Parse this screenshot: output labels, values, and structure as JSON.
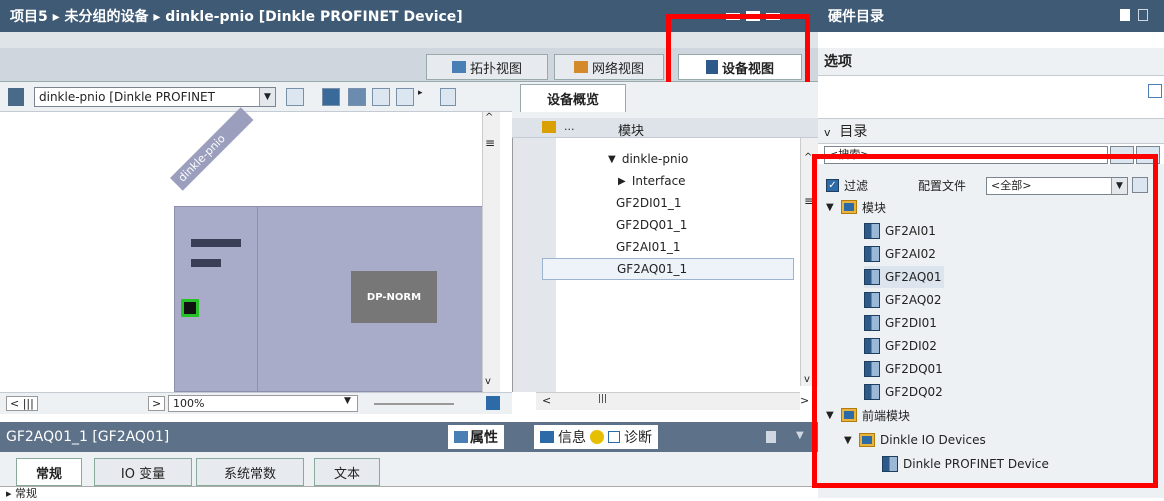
{
  "titlebar": {
    "path": "项目5 ▸ 未分组的设备 ▸ dinkle-pnio [Dinkle PROFINET Device]"
  },
  "view_tabs": [
    {
      "label": "拓扑视图",
      "icon": "topology-view-icon"
    },
    {
      "label": "网络视图",
      "icon": "network-view-icon"
    },
    {
      "label": "设备视图",
      "icon": "device-view-icon"
    }
  ],
  "toolbar": {
    "device_select": "dinkle-pnio [Dinkle PROFINET",
    "zoom": "100%"
  },
  "canvas": {
    "device_label": "dinkle-pnio",
    "module_label": "DP-NORM"
  },
  "overview": {
    "tab_label": "设备概览",
    "column_module": "模块",
    "rows": [
      "dinkle-pnio",
      "Interface",
      "GF2DI01_1",
      "GF2DQ01_1",
      "GF2AI01_1",
      "GF2AQ01_1"
    ]
  },
  "properties": {
    "title": "GF2AQ01_1 [GF2AQ01]",
    "tab_properties": "属性",
    "tab_info": "信息",
    "tab_diag": "诊断",
    "tabs": [
      "常规",
      "IO 变量",
      "系统常数",
      "文本"
    ],
    "sub_item": "常规"
  },
  "catalog": {
    "panel_title": "硬件目录",
    "options_label": "选项",
    "catalog_label": "目录",
    "search_placeholder": "<搜索>",
    "filter_label": "过滤",
    "profile_label": "配置文件",
    "profile_value": "<全部>",
    "folder_modules": "模块",
    "modules": [
      "GF2AI01",
      "GF2AI02",
      "GF2AQ01",
      "GF2AQ02",
      "GF2DI01",
      "GF2DI02",
      "GF2DQ01",
      "GF2DQ02"
    ],
    "folder_headend": "前端模块",
    "folder_io_devices": "Dinkle IO Devices",
    "device_item": "Dinkle PROFINET Device"
  },
  "colors": {
    "title_bg": "#3f5a75",
    "highlight_box": "#ff0000",
    "rack": "#a8acc8",
    "module": "#777777"
  }
}
